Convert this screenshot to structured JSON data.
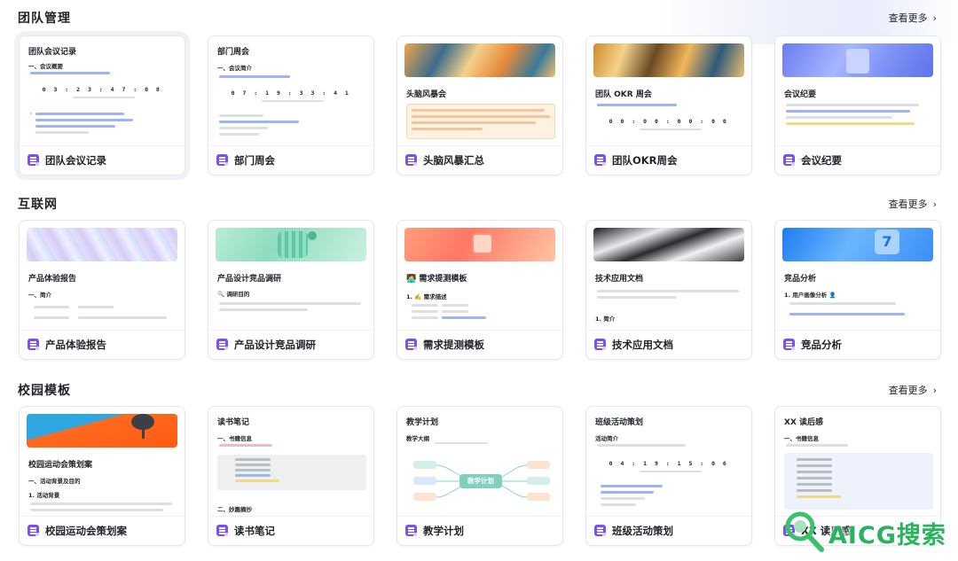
{
  "sections": [
    {
      "title": "团队管理",
      "see_more": "查看更多",
      "cards": [
        {
          "label": "团队会议记录",
          "preview_title": "团队会议记录",
          "preview_heading": "一、会议概要",
          "preview_timer": "0 3 : 2 3 : 4 7 : 0 8"
        },
        {
          "label": "部门周会",
          "preview_title": "部门周会",
          "preview_heading": "一、会议简介",
          "preview_timer": "0 7 : 1 9 : 3 3 : 4 1"
        },
        {
          "label": "头脑风暴汇总",
          "preview_title": "头脑风暴会"
        },
        {
          "label": "团队OKR周会",
          "preview_title": "团队 OKR 周会",
          "preview_timer": "0 0 : 0 0 : 0 0 : 0 0"
        },
        {
          "label": "会议纪要",
          "preview_title": "会议纪要"
        }
      ]
    },
    {
      "title": "互联网",
      "see_more": "查看更多",
      "cards": [
        {
          "label": "产品体验报告",
          "preview_title": "产品体验报告",
          "preview_heading": "一、简介"
        },
        {
          "label": "产品设计竞品调研",
          "preview_title": "产品设计竞品调研",
          "preview_heading": "🔍 调研目的"
        },
        {
          "label": "需求提测模板",
          "preview_title": "🧑‍💻 需求提测模板",
          "preview_heading": "1. ✍️ 需求描述"
        },
        {
          "label": "技术应用文档",
          "preview_title": "技术应用文档",
          "preview_heading": "1. 简介"
        },
        {
          "label": "竞品分析",
          "preview_title": "竞品分析",
          "preview_heading": "1. 用户画像分析 👤"
        }
      ]
    },
    {
      "title": "校园模板",
      "see_more": "查看更多",
      "cards": [
        {
          "label": "校园运动会策划案",
          "preview_title": "校园运动会策划案",
          "preview_heading": "一、活动背景及目的",
          "preview_sub": "1. 活动背景"
        },
        {
          "label": "读书笔记",
          "preview_title": "读书笔记",
          "preview_heading": "一、书籍信息",
          "preview_heading2": "二、妙趣摘抄"
        },
        {
          "label": "教学计划",
          "preview_title": "教学计划",
          "preview_heading": "教学大纲",
          "preview_center": "教学计划"
        },
        {
          "label": "班级活动策划",
          "preview_title": "班级活动策划",
          "preview_heading": "活动简介",
          "preview_timer": "0 4 : 1 9 : 1 5 : 0 6"
        },
        {
          "label": "XX 读后感",
          "preview_title": "XX 读后感",
          "preview_heading": "一、书籍信息"
        }
      ]
    }
  ],
  "watermark": {
    "text": "AICG搜索"
  },
  "colors": {
    "doc_icon": "#7b4ff1",
    "card_border": "#e4e6eb",
    "accent_blue": "#3370ff"
  }
}
